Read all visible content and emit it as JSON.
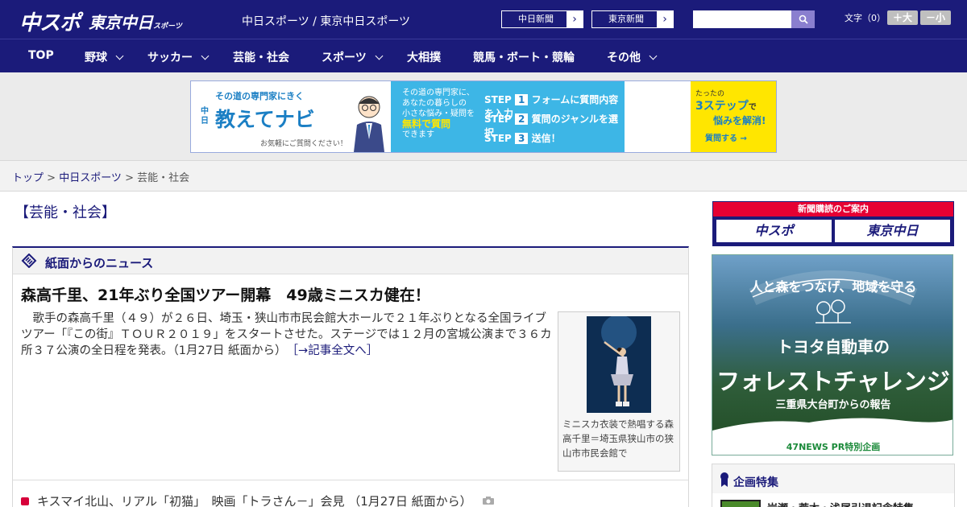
{
  "header": {
    "logo_chuspo": "中スポ",
    "logo_tokyo": "東京中日",
    "logo_tokyo_small": "スポーツ",
    "site_link": "中日スポーツ / 東京中日スポーツ",
    "chunichi_btn": "中日新聞",
    "tokyo_btn": "東京新聞",
    "fontsize_label": "文字（0）",
    "fontsize_up": "＋大",
    "fontsize_down": "－小"
  },
  "nav": {
    "items": [
      "TOP",
      "野球",
      "サッカー",
      "芸能・社会",
      "スポーツ",
      "大相撲",
      "競馬・ボート・競輪",
      "その他"
    ]
  },
  "banner": {
    "title_small": "その道の専門家にきく",
    "title_brand": "中日",
    "title_main": "教えてナビ",
    "note": "お気軽にご質問ください！",
    "mid_line1": "その道の専門家に、",
    "mid_line2": "あなたの暮らしの",
    "mid_line3": "小さな悩み・疑問を",
    "mid_free": "無料で質問",
    "mid_line4": "できます",
    "step1": "フォームに質問内容を入力",
    "step2": "質問のジャンルを選択",
    "step3": "送信！",
    "step_label": "STEP",
    "right_small": "たったの",
    "right_big": "3ステップ",
    "right_de": "で",
    "right_sub": "悩みを解消!",
    "right_btn": "質問する"
  },
  "breadcrumb": {
    "top": "トップ",
    "sep1": " > ",
    "chunichi": "中日スポーツ",
    "sep2": " > ",
    "current": "芸能・社会"
  },
  "main": {
    "page_title": "【芸能・社会】",
    "section_label": "紙面からのニュース",
    "headline": "森高千里、21年ぶり全国ツアー開幕　49歳ミニスカ健在！",
    "body": "歌手の森高千里（４９）が２６日、埼玉・狭山市市民会館大ホールで２１年ぶりとなる全国ライブツアー「『この街』ＴＯＵＲ２０１９」をスタートさせた。ステージでは１２月の宮城公演まで３６カ所３７公演の全日程を発表。（1月27日 紙面から）",
    "more": "［→記事全文へ］",
    "photo_caption": "ミニスカ衣装で熱唱する森高千里＝埼玉県狭山市の狭山市市民会館で",
    "sub_item": "キスマイ北山、リアル「初猫」　映画「トラさん－」会見 （1月27日 紙面から）"
  },
  "sidebar": {
    "subscribe_label": "新聞購読のご案内",
    "subscribe_chuspo": "中スポ",
    "subscribe_tokyo": "東京中日",
    "ad_line1": "人と森をつなげ、地域を守る",
    "ad_line2": "トヨタ自動車の",
    "ad_line3": "フォレストチャレンジ",
    "ad_line4": "三重県大台町からの報告",
    "ad_line5": "47NEWS PR特別企画",
    "feature_title": "企画特集",
    "feature_item": "岩瀬・荒木・浅尾引退記念特集"
  }
}
